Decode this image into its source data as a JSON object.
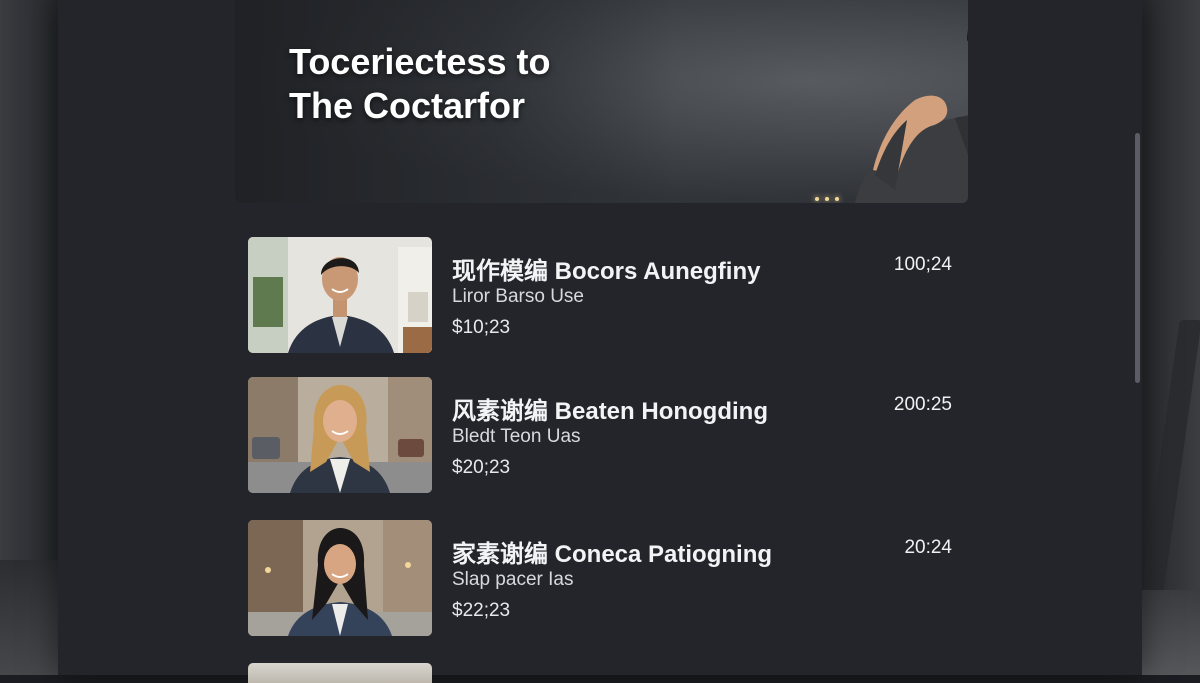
{
  "hero": {
    "title_line1": "Toceriectess to",
    "title_line2": "The Coctarfor"
  },
  "items": [
    {
      "title": "现作模编 Bocors Aunegfiny",
      "subtitle": "Liror Barso Use",
      "price": "$10;23",
      "time": "100;24",
      "thumb_bg": "#e9e7e2",
      "thumb_scene": "indoor"
    },
    {
      "title": "风素谢编 Beaten Honogding",
      "subtitle": "Bledt Teon Uas",
      "price": "$20;23",
      "time": "200:25",
      "thumb_bg": "#b8b0a3",
      "thumb_scene": "street"
    },
    {
      "title": "家素谢编 Coneca Patiogning",
      "subtitle": "Slap pacer Ias",
      "price": "$22;23",
      "time": "20:24",
      "thumb_bg": "#a89c8e",
      "thumb_scene": "street"
    }
  ],
  "colors": {
    "panel": "#23252b",
    "text_primary": "#f2f3f5",
    "text_secondary": "#d7d9dd"
  }
}
